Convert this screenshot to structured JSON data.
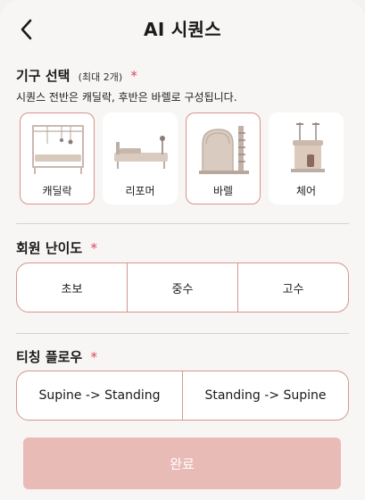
{
  "header": {
    "title": "AI 시퀀스"
  },
  "equipment": {
    "title": "기구 선택",
    "subtitle": "(최대 2개)",
    "required_mark": "*",
    "description": "시퀀스 전반은 캐딜락, 후반은 바렐로 구성됩니다.",
    "items": [
      {
        "label": "캐딜락",
        "icon": "cadillac-icon",
        "selected": true
      },
      {
        "label": "리포머",
        "icon": "reformer-icon",
        "selected": false
      },
      {
        "label": "바렐",
        "icon": "barrel-icon",
        "selected": true
      },
      {
        "label": "체어",
        "icon": "chair-icon",
        "selected": false
      }
    ]
  },
  "level": {
    "title": "회원 난이도",
    "required_mark": "*",
    "options": [
      "초보",
      "중수",
      "고수"
    ]
  },
  "flow": {
    "title": "티칭 플로우",
    "required_mark": "*",
    "options": [
      "Supine -> Standing",
      "Standing -> Supine"
    ]
  },
  "submit": {
    "label": "완료"
  },
  "colors": {
    "accent_border": "#d4968f",
    "button_bg": "#e8bbb6",
    "required": "#e0475b"
  }
}
